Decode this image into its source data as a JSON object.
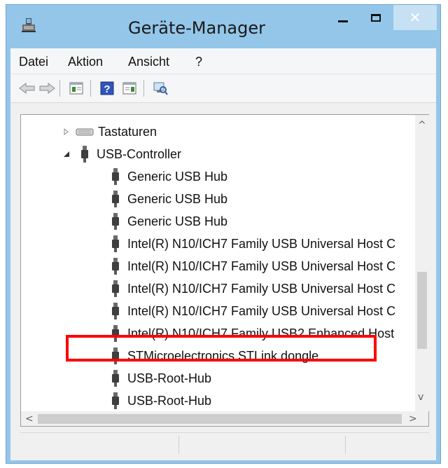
{
  "window": {
    "title": "Geräte-Manager",
    "close_glyph": "✕",
    "accent_color": "#93c6e9"
  },
  "menu": {
    "items": [
      "Datei",
      "Aktion",
      "Ansicht",
      "?"
    ]
  },
  "toolbar": {
    "buttons": [
      "back-arrow-icon",
      "forward-arrow-icon",
      "properties-icon",
      "help-icon",
      "update-driver-icon",
      "scan-hardware-icon"
    ]
  },
  "tree": {
    "categories": [
      {
        "label": "Tastaturen",
        "expanded": false,
        "icon": "keyboard-icon"
      },
      {
        "label": "USB-Controller",
        "expanded": true,
        "icon": "usb-plug-icon"
      }
    ],
    "usb_devices": [
      "Generic USB Hub",
      "Generic USB Hub",
      "Generic USB Hub",
      "Intel(R) N10/ICH7 Family USB Universal Host C",
      "Intel(R) N10/ICH7 Family USB Universal Host C",
      "Intel(R) N10/ICH7 Family USB Universal Host C",
      "Intel(R) N10/ICH7 Family USB Universal Host C",
      "Intel(R) N10/ICH7 Family USB2 Enhanced Host",
      "STMicroelectronics STLink dongle",
      "USB-Root-Hub",
      "USB-Root-Hub"
    ],
    "highlighted_device": "STMicroelectronics STLink dongle",
    "highlight_color": "#ff0000"
  },
  "scrollbars": {
    "up_glyph": "^",
    "down_glyph": "v",
    "left_glyph": "<",
    "right_glyph": ">"
  }
}
